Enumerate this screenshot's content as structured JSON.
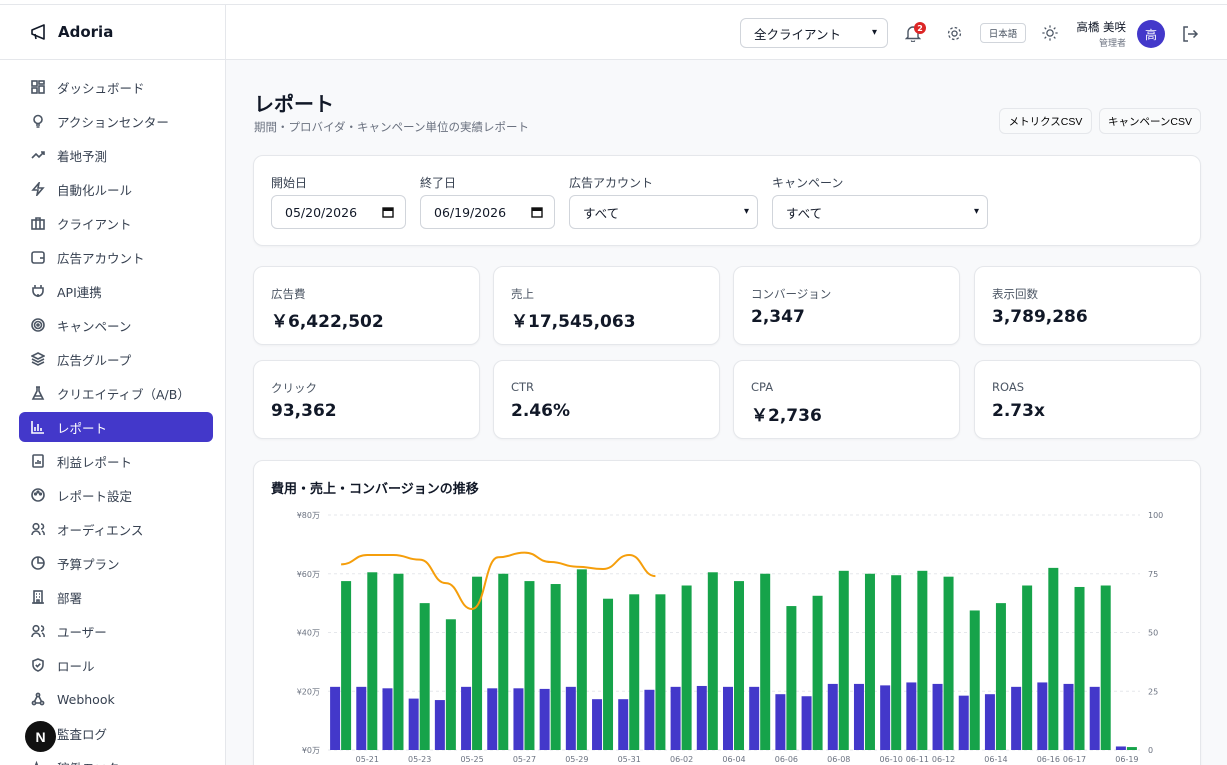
{
  "app": {
    "name": "Adoria"
  },
  "sidebar": {
    "items": [
      {
        "label": "ダッシュボード",
        "icon": "dashboard-icon"
      },
      {
        "label": "アクションセンター",
        "icon": "lightbulb-icon"
      },
      {
        "label": "着地予測",
        "icon": "trend-up-icon"
      },
      {
        "label": "自動化ルール",
        "icon": "lightning-icon"
      },
      {
        "label": "クライアント",
        "icon": "briefcase-icon"
      },
      {
        "label": "広告アカウント",
        "icon": "wallet-icon"
      },
      {
        "label": "API連携",
        "icon": "plug-icon"
      },
      {
        "label": "キャンペーン",
        "icon": "target-icon"
      },
      {
        "label": "広告グループ",
        "icon": "layers-icon"
      },
      {
        "label": "クリエイティブ（A/B）",
        "icon": "flask-icon"
      },
      {
        "label": "レポート",
        "icon": "bar-chart-icon",
        "active": true
      },
      {
        "label": "利益レポート",
        "icon": "file-chart-icon"
      },
      {
        "label": "レポート設定",
        "icon": "palette-icon"
      },
      {
        "label": "オーディエンス",
        "icon": "audience-icon"
      },
      {
        "label": "予算プラン",
        "icon": "pie-icon"
      },
      {
        "label": "部署",
        "icon": "building-icon"
      },
      {
        "label": "ユーザー",
        "icon": "users-icon"
      },
      {
        "label": "ロール",
        "icon": "shield-icon"
      },
      {
        "label": "Webhook",
        "icon": "webhook-icon"
      },
      {
        "label": "監査ログ",
        "icon": "log-icon"
      },
      {
        "label": "稼働モニター",
        "icon": "activity-icon"
      }
    ],
    "badge": "N"
  },
  "header": {
    "client_select": "全クライアント",
    "notification_count": "2",
    "language": "日本語",
    "user_name": "高橋 美咲",
    "user_role": "管理者",
    "avatar": "高"
  },
  "page": {
    "title": "レポート",
    "subtitle": "期間・プロバイダ・キャンペーン単位の実績レポート",
    "metrics_csv": "メトリクスCSV",
    "campaign_csv": "キャンペーンCSV"
  },
  "filters": {
    "start_label": "開始日",
    "start_value": "05/20/2026",
    "end_label": "終了日",
    "end_value": "06/19/2026",
    "account_label": "広告アカウント",
    "account_value": "すべて",
    "campaign_label": "キャンペーン",
    "campaign_value": "すべて"
  },
  "kpis": [
    {
      "label": "広告費",
      "value": "￥6,422,502"
    },
    {
      "label": "売上",
      "value": "￥17,545,063"
    },
    {
      "label": "コンバージョン",
      "value": "2,347"
    },
    {
      "label": "表示回数",
      "value": "3,789,286"
    },
    {
      "label": "クリック",
      "value": "93,362"
    },
    {
      "label": "CTR",
      "value": "2.46%"
    },
    {
      "label": "CPA",
      "value": "￥2,736"
    },
    {
      "label": "ROAS",
      "value": "2.73x"
    }
  ],
  "chart_title": "費用・売上・コンバージョンの推移",
  "chart_data": {
    "type": "bar",
    "x": [
      "05-20",
      "05-21",
      "05-22",
      "05-23",
      "05-24",
      "05-25",
      "05-26",
      "05-27",
      "05-28",
      "05-29",
      "05-30",
      "05-31",
      "06-01",
      "06-02",
      "06-03",
      "06-04",
      "06-05",
      "06-06",
      "06-07",
      "06-08",
      "06-09",
      "06-10",
      "06-11",
      "06-12",
      "06-13",
      "06-14",
      "06-15",
      "06-16",
      "06-17",
      "06-18",
      "06-19"
    ],
    "x_tick_labels": [
      "05-21",
      "05-23",
      "05-25",
      "05-27",
      "05-29",
      "05-31",
      "06-02",
      "06-04",
      "06-06",
      "06-08",
      "06-10",
      "06-11",
      "06-12",
      "06-14",
      "06-16",
      "06-17",
      "06-19"
    ],
    "series": [
      {
        "color": "#4338ca",
        "axis": "left",
        "values": [
          21.5,
          21.5,
          21,
          17.5,
          17,
          21.5,
          21,
          21,
          20.8,
          21.5,
          17.3,
          17.3,
          20.5,
          21.5,
          21.8,
          21.5,
          21.5,
          19,
          18.3,
          22.5,
          22.5,
          22,
          23,
          22.5,
          18.5,
          19,
          21.5,
          23,
          22.5,
          21.5,
          1.2
        ]
      },
      {
        "color": "#16a34a",
        "axis": "left",
        "values": [
          57.5,
          60.5,
          60,
          50,
          44.5,
          59,
          60,
          57.5,
          56.5,
          61.5,
          51.5,
          53,
          53,
          56,
          60.5,
          57.5,
          60,
          49,
          52.5,
          61,
          60,
          59.5,
          61,
          59,
          47.5,
          50,
          56,
          62,
          55.5,
          56,
          1
        ]
      },
      {
        "color": "#f59e0b",
        "axis": "right",
        "type": "line",
        "values": [
          79,
          83,
          83,
          81,
          71,
          60,
          82,
          84,
          80,
          78,
          77,
          83,
          74
        ]
      }
    ],
    "y_left": {
      "ticks": [
        "¥0万",
        "¥20万",
        "¥40万",
        "¥60万",
        "¥80万"
      ],
      "range": [
        0,
        80
      ]
    },
    "y_right": {
      "ticks": [
        "0",
        "25",
        "50",
        "75",
        "100"
      ],
      "range": [
        0,
        100
      ]
    },
    "grid": true
  }
}
